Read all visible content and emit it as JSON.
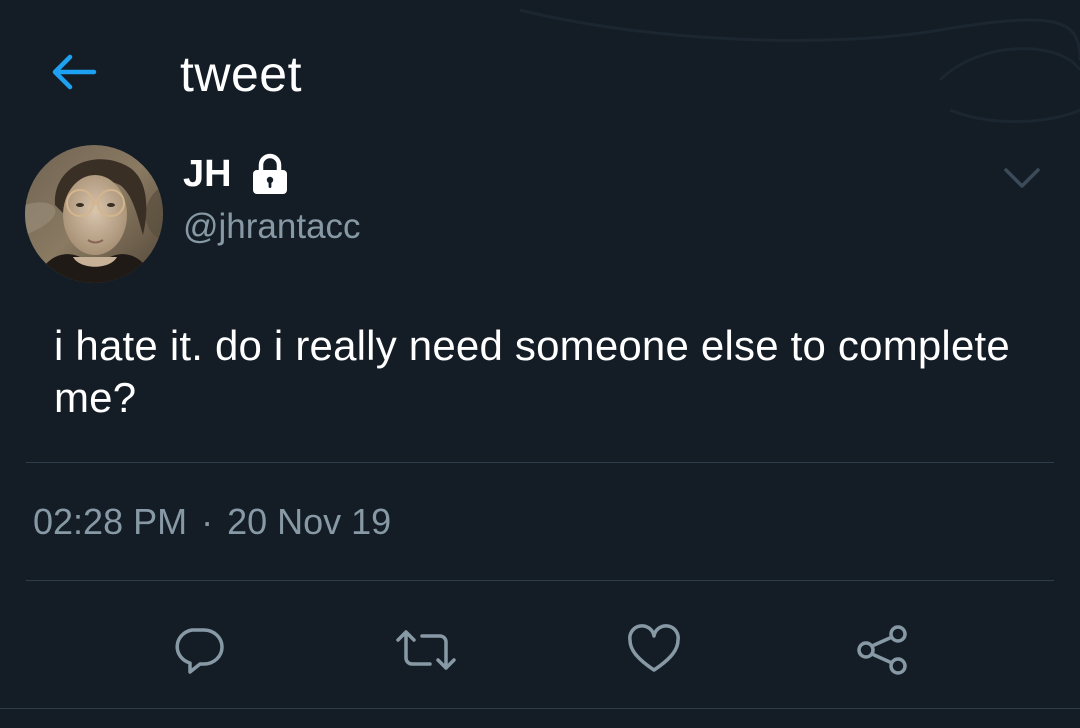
{
  "colors": {
    "background": "#141d26",
    "accent": "#1da1f2",
    "text_primary": "#ffffff",
    "text_secondary": "#8899a6",
    "divider": "#2f3c4a"
  },
  "header": {
    "back_icon": "arrow-left-icon",
    "title": "tweet"
  },
  "tweet": {
    "display_name": "JH",
    "protected_icon": "lock-icon",
    "handle": "@jhrantacc",
    "more_icon": "chevron-down-icon",
    "text": "i hate it. do i really need someone else to complete me?",
    "time": "02:28 PM",
    "separator": "·",
    "date": "20 Nov 19"
  },
  "actions": [
    {
      "name": "reply",
      "icon": "reply-icon"
    },
    {
      "name": "retweet",
      "icon": "retweet-icon"
    },
    {
      "name": "like",
      "icon": "heart-icon"
    },
    {
      "name": "share",
      "icon": "share-icon"
    }
  ]
}
